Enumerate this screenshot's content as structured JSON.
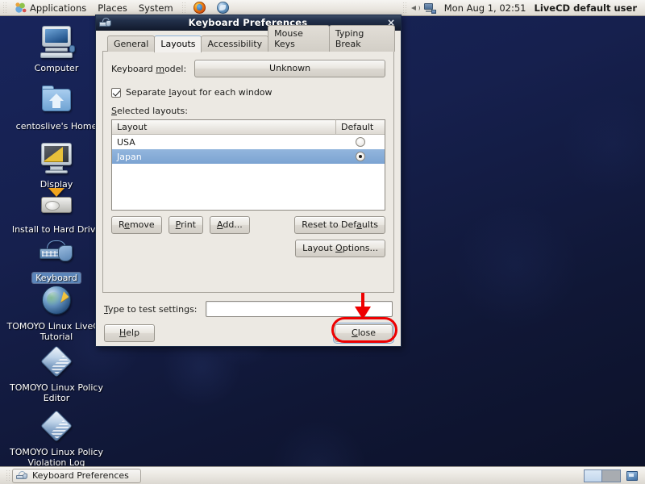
{
  "top_panel": {
    "logo_icon": "gnome-foot-icon",
    "menus": [
      {
        "label": "Applications",
        "name": "menu-applications"
      },
      {
        "label": "Places",
        "name": "menu-places"
      },
      {
        "label": "System",
        "name": "menu-system"
      }
    ],
    "launchers": [
      {
        "name": "firefox-launcher-icon",
        "title": "Firefox"
      },
      {
        "name": "evolution-launcher-icon",
        "title": "Evolution"
      }
    ],
    "tray": [
      {
        "name": "volume-icon"
      },
      {
        "name": "network-icon"
      }
    ],
    "clock": "Mon Aug  1, 02:51",
    "user": "LiveCD default user"
  },
  "desktop": {
    "icons": [
      {
        "label": "Computer",
        "icon": "computer-icon",
        "selected": false
      },
      {
        "label": "centoslive's Home",
        "icon": "home-folder-icon",
        "selected": false
      },
      {
        "label": "Display",
        "icon": "display-icon",
        "selected": false
      },
      {
        "label": "Install to Hard Drive",
        "icon": "hard-drive-icon",
        "selected": false
      },
      {
        "label": "Keyboard",
        "icon": "keyboard-icon",
        "selected": true
      },
      {
        "label": "TOMOYO Linux LiveCD Tutorial",
        "icon": "globe-icon",
        "selected": false
      },
      {
        "label": "TOMOYO Linux Policy Editor",
        "icon": "diamond-icon",
        "selected": false
      },
      {
        "label": "TOMOYO Linux Policy Violation Log",
        "icon": "diamond-icon",
        "selected": false
      }
    ]
  },
  "dialog": {
    "title": "Keyboard Preferences",
    "title_icon": "keyboard-prefs-icon",
    "close_x": "×",
    "tabs": [
      {
        "label": "General",
        "active": false
      },
      {
        "label": "Layouts",
        "active": true
      },
      {
        "label": "Accessibility",
        "active": false
      },
      {
        "label": "Mouse Keys",
        "active": false
      },
      {
        "label": "Typing Break",
        "active": false
      }
    ],
    "keyboard_model": {
      "label": "Keyboard model:",
      "mnemonic": "m",
      "value": "Unknown"
    },
    "separate_layout": {
      "label": "Separate layout for each window",
      "mnemonic": "l",
      "checked": true
    },
    "selected_layouts_label": "Selected layouts:",
    "list": {
      "columns": [
        "Layout",
        "Default"
      ],
      "rows": [
        {
          "layout": "USA",
          "default": false,
          "selected": false
        },
        {
          "layout": "Japan",
          "default": true,
          "selected": true
        }
      ]
    },
    "buttons": {
      "remove": "Remove",
      "print": "Print",
      "add": "Add...",
      "reset": "Reset to Defaults",
      "layout_options": "Layout Options...",
      "help": "Help",
      "close": "Close"
    },
    "test_field": {
      "label": "Type to test settings:",
      "mnemonic": "T",
      "value": "",
      "placeholder": ""
    }
  },
  "annotations": {
    "accent_color": "#ee0000",
    "items": [
      {
        "name": "highlight-default-radio-japan",
        "shape": "circle"
      },
      {
        "name": "arrow-to-close-button",
        "shape": "arrow"
      },
      {
        "name": "highlight-close-button",
        "shape": "rounded-rect"
      }
    ]
  },
  "bottom_panel": {
    "task": {
      "label": "Keyboard Preferences",
      "icon": "keyboard-prefs-icon"
    },
    "workspaces": [
      {
        "name": "workspace-1",
        "active": true
      },
      {
        "name": "workspace-2",
        "active": false
      }
    ],
    "trash": {
      "name": "trash-icon"
    }
  }
}
